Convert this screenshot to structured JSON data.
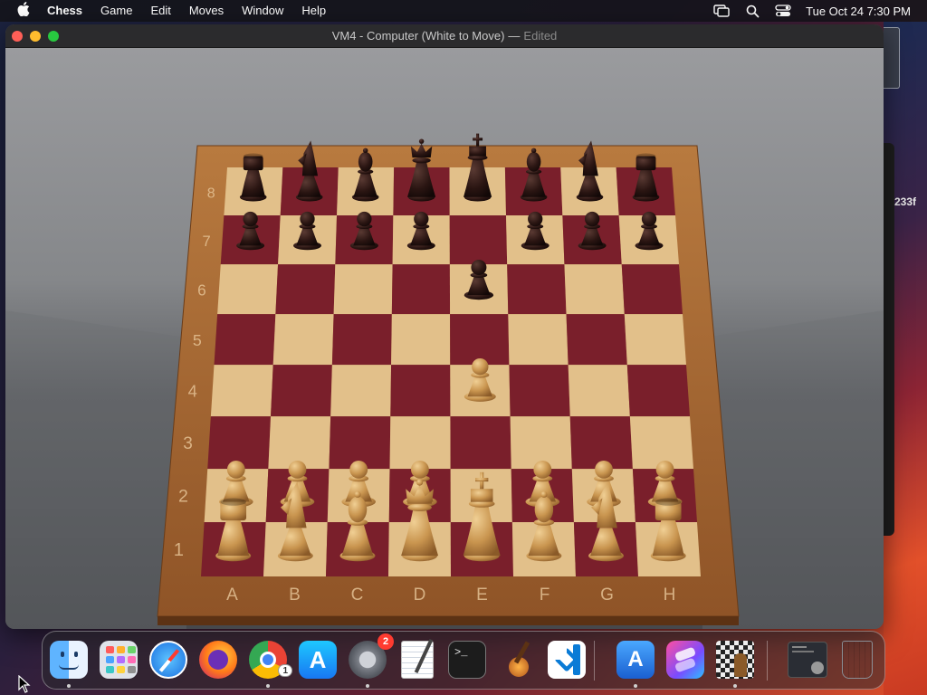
{
  "menubar": {
    "apple_label": "",
    "app_name": "Chess",
    "items": [
      "Game",
      "Edit",
      "Moves",
      "Window",
      "Help"
    ],
    "clock": "Tue Oct 24  7:30 PM",
    "status_icons": [
      "screen-mirroring-icon",
      "spotlight-search-icon",
      "control-center-icon"
    ]
  },
  "window": {
    "title": "VM4 - Computer   (White to Move)",
    "separator": "—",
    "edited": "Edited"
  },
  "board": {
    "ranks": [
      "8",
      "7",
      "6",
      "5",
      "4",
      "3",
      "2",
      "1"
    ],
    "files": [
      "A",
      "B",
      "C",
      "D",
      "E",
      "F",
      "G",
      "H"
    ],
    "position": {
      "a8": "bR",
      "b8": "bN",
      "c8": "bB",
      "d8": "bQ",
      "e8": "bK",
      "f8": "bB",
      "g8": "bN",
      "h8": "bR",
      "a7": "bP",
      "b7": "bP",
      "c7": "bP",
      "d7": "bP",
      "f7": "bP",
      "g7": "bP",
      "h7": "bP",
      "e6": "bP",
      "e4": "wP",
      "a2": "wP",
      "b2": "wP",
      "c2": "wP",
      "d2": "wP",
      "f2": "wP",
      "g2": "wP",
      "h2": "wP",
      "a1": "wR",
      "b1": "wN",
      "c1": "wB",
      "d1": "wQ",
      "e1": "wK",
      "f1": "wB",
      "g1": "wN",
      "h1": "wR"
    },
    "colors": {
      "light_square": "#e2c08a",
      "dark_square": "#7a1f2b",
      "frame": "#a8652e",
      "black_piece": "#2a1512",
      "white_piece": "#c9954f"
    }
  },
  "side_label": "233f",
  "dock": {
    "items": [
      {
        "name": "finder",
        "icon": "finder-icon",
        "running": true
      },
      {
        "name": "launchpad",
        "icon": "launchpad-icon",
        "running": false
      },
      {
        "name": "safari",
        "icon": "safari-icon",
        "running": false
      },
      {
        "name": "firefox",
        "icon": "firefox-icon",
        "running": false
      },
      {
        "name": "chrome",
        "icon": "chrome-icon",
        "running": true,
        "badge": "1"
      },
      {
        "name": "app-store",
        "icon": "app-store-icon",
        "running": false
      },
      {
        "name": "system-settings",
        "icon": "gear-icon",
        "running": true,
        "badge": "2"
      },
      {
        "name": "textedit",
        "icon": "textedit-icon",
        "running": false
      },
      {
        "name": "terminal",
        "icon": "terminal-icon",
        "running": false
      },
      {
        "name": "garageband",
        "icon": "guitar-icon",
        "running": false
      },
      {
        "name": "vscode",
        "icon": "vscode-icon",
        "running": false
      },
      {
        "name": "xcode-instruments",
        "icon": "xcode-icon",
        "running": true
      },
      {
        "name": "shortcuts",
        "icon": "shortcuts-icon",
        "running": false
      },
      {
        "name": "chess",
        "icon": "chess-icon",
        "running": true
      },
      {
        "name": "downloads",
        "icon": "downloads-folder-icon",
        "running": false
      },
      {
        "name": "trash",
        "icon": "trash-icon",
        "running": false
      }
    ],
    "terminal_prompt": ">_"
  }
}
